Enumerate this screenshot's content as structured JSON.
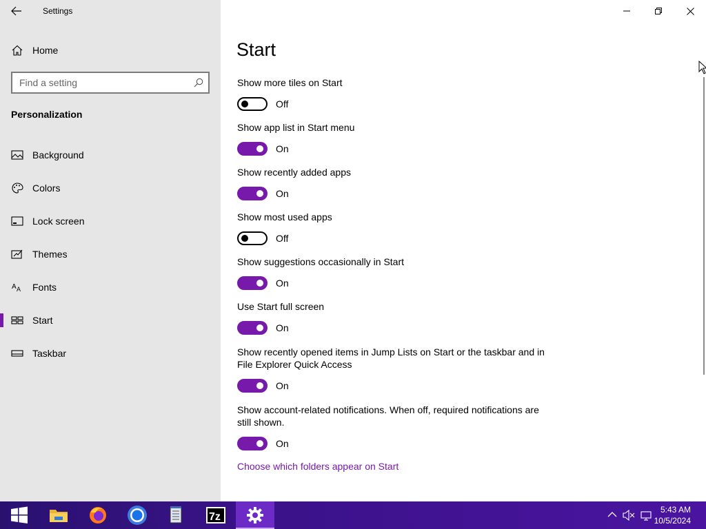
{
  "window": {
    "title": "Settings"
  },
  "sidebar": {
    "home_label": "Home",
    "search_placeholder": "Find a setting",
    "section": "Personalization",
    "items": [
      {
        "label": "Background",
        "icon": "picture-icon"
      },
      {
        "label": "Colors",
        "icon": "palette-icon"
      },
      {
        "label": "Lock screen",
        "icon": "lock-screen-icon"
      },
      {
        "label": "Themes",
        "icon": "themes-icon"
      },
      {
        "label": "Fonts",
        "icon": "fonts-icon"
      },
      {
        "label": "Start",
        "icon": "start-tiles-icon",
        "selected": true
      },
      {
        "label": "Taskbar",
        "icon": "taskbar-icon"
      }
    ]
  },
  "main": {
    "title": "Start",
    "settings": [
      {
        "label": "Show more tiles on Start",
        "state": "Off",
        "on": false
      },
      {
        "label": "Show app list in Start menu",
        "state": "On",
        "on": true
      },
      {
        "label": "Show recently added apps",
        "state": "On",
        "on": true
      },
      {
        "label": "Show most used apps",
        "state": "Off",
        "on": false
      },
      {
        "label": "Show suggestions occasionally in Start",
        "state": "On",
        "on": true
      },
      {
        "label": "Use Start full screen",
        "state": "On",
        "on": true
      },
      {
        "label": "Show recently opened items in Jump Lists on Start or the taskbar and in File Explorer Quick Access",
        "state": "On",
        "on": true
      },
      {
        "label": "Show account-related notifications. When off, required notifications are still shown.",
        "state": "On",
        "on": true
      }
    ],
    "link": "Choose which folders appear on Start"
  },
  "taskbar": {
    "apps": [
      "start-icon",
      "file-explorer-icon",
      "firefox-icon",
      "chrome-icon",
      "notepad-icon",
      "7zip-icon",
      "settings-icon"
    ],
    "time": "5:43 AM",
    "date": "10/5/2024"
  },
  "colors": {
    "accent": "#7719aa",
    "sidebar_bg": "#e6e6e6",
    "taskbar": "#3b128a"
  }
}
